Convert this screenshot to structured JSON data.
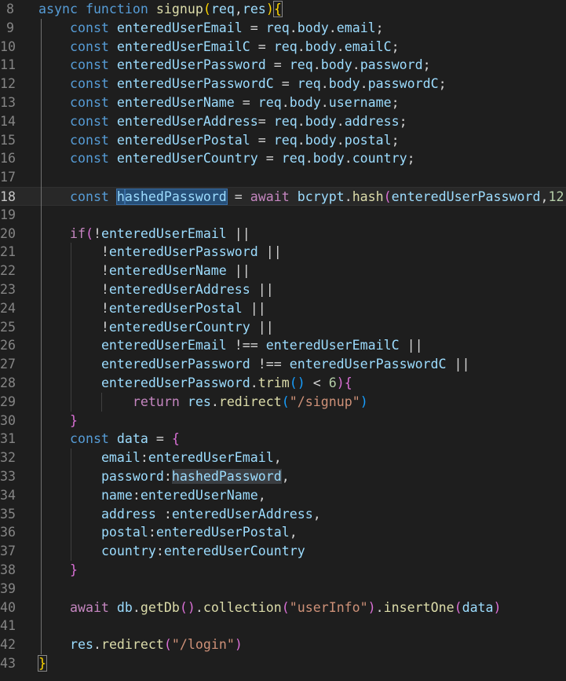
{
  "editor": {
    "current_line": "18",
    "lines": [
      {
        "n": "8",
        "tokens": [
          {
            "t": "async",
            "c": "tok-kw"
          },
          {
            "t": " "
          },
          {
            "t": "function",
            "c": "tok-kw"
          },
          {
            "t": " "
          },
          {
            "t": "signup",
            "c": "tok-fn"
          },
          {
            "t": "(",
            "c": "b1"
          },
          {
            "t": "req",
            "c": "tok-var"
          },
          {
            "t": ","
          },
          {
            "t": "res",
            "c": "tok-var"
          },
          {
            "t": ")",
            "c": "b1"
          },
          {
            "t": "{",
            "c": "b1 hl-bracket"
          }
        ]
      },
      {
        "n": "9",
        "tokens": [
          {
            "t": "    "
          },
          {
            "t": "const",
            "c": "tok-kw"
          },
          {
            "t": " "
          },
          {
            "t": "enteredUserEmail",
            "c": "tok-var"
          },
          {
            "t": " = "
          },
          {
            "t": "req",
            "c": "tok-var"
          },
          {
            "t": "."
          },
          {
            "t": "body",
            "c": "tok-var"
          },
          {
            "t": "."
          },
          {
            "t": "email",
            "c": "tok-var"
          },
          {
            "t": ";"
          }
        ]
      },
      {
        "n": "10",
        "tokens": [
          {
            "t": "    "
          },
          {
            "t": "const",
            "c": "tok-kw"
          },
          {
            "t": " "
          },
          {
            "t": "enteredUserEmailC",
            "c": "tok-var"
          },
          {
            "t": " = "
          },
          {
            "t": "req",
            "c": "tok-var"
          },
          {
            "t": "."
          },
          {
            "t": "body",
            "c": "tok-var"
          },
          {
            "t": "."
          },
          {
            "t": "emailC",
            "c": "tok-var"
          },
          {
            "t": ";"
          }
        ]
      },
      {
        "n": "11",
        "tokens": [
          {
            "t": "    "
          },
          {
            "t": "const",
            "c": "tok-kw"
          },
          {
            "t": " "
          },
          {
            "t": "enteredUserPassword",
            "c": "tok-var"
          },
          {
            "t": " = "
          },
          {
            "t": "req",
            "c": "tok-var"
          },
          {
            "t": "."
          },
          {
            "t": "body",
            "c": "tok-var"
          },
          {
            "t": "."
          },
          {
            "t": "password",
            "c": "tok-var"
          },
          {
            "t": ";"
          }
        ]
      },
      {
        "n": "12",
        "tokens": [
          {
            "t": "    "
          },
          {
            "t": "const",
            "c": "tok-kw"
          },
          {
            "t": " "
          },
          {
            "t": "enteredUserPasswordC",
            "c": "tok-var"
          },
          {
            "t": " = "
          },
          {
            "t": "req",
            "c": "tok-var"
          },
          {
            "t": "."
          },
          {
            "t": "body",
            "c": "tok-var"
          },
          {
            "t": "."
          },
          {
            "t": "passwordC",
            "c": "tok-var"
          },
          {
            "t": ";"
          }
        ]
      },
      {
        "n": "13",
        "tokens": [
          {
            "t": "    "
          },
          {
            "t": "const",
            "c": "tok-kw"
          },
          {
            "t": " "
          },
          {
            "t": "enteredUserName",
            "c": "tok-var"
          },
          {
            "t": " = "
          },
          {
            "t": "req",
            "c": "tok-var"
          },
          {
            "t": "."
          },
          {
            "t": "body",
            "c": "tok-var"
          },
          {
            "t": "."
          },
          {
            "t": "username",
            "c": "tok-var"
          },
          {
            "t": ";"
          }
        ]
      },
      {
        "n": "14",
        "tokens": [
          {
            "t": "    "
          },
          {
            "t": "const",
            "c": "tok-kw"
          },
          {
            "t": " "
          },
          {
            "t": "enteredUserAddress",
            "c": "tok-var"
          },
          {
            "t": "= "
          },
          {
            "t": "req",
            "c": "tok-var"
          },
          {
            "t": "."
          },
          {
            "t": "body",
            "c": "tok-var"
          },
          {
            "t": "."
          },
          {
            "t": "address",
            "c": "tok-var"
          },
          {
            "t": ";"
          }
        ]
      },
      {
        "n": "15",
        "tokens": [
          {
            "t": "    "
          },
          {
            "t": "const",
            "c": "tok-kw"
          },
          {
            "t": " "
          },
          {
            "t": "enteredUserPostal",
            "c": "tok-var"
          },
          {
            "t": " = "
          },
          {
            "t": "req",
            "c": "tok-var"
          },
          {
            "t": "."
          },
          {
            "t": "body",
            "c": "tok-var"
          },
          {
            "t": "."
          },
          {
            "t": "postal",
            "c": "tok-var"
          },
          {
            "t": ";"
          }
        ]
      },
      {
        "n": "16",
        "tokens": [
          {
            "t": "    "
          },
          {
            "t": "const",
            "c": "tok-kw"
          },
          {
            "t": " "
          },
          {
            "t": "enteredUserCountry",
            "c": "tok-var"
          },
          {
            "t": " = "
          },
          {
            "t": "req",
            "c": "tok-var"
          },
          {
            "t": "."
          },
          {
            "t": "body",
            "c": "tok-var"
          },
          {
            "t": "."
          },
          {
            "t": "country",
            "c": "tok-var"
          },
          {
            "t": ";"
          }
        ]
      },
      {
        "n": "17",
        "tokens": []
      },
      {
        "n": "18",
        "tokens": [
          {
            "t": "    "
          },
          {
            "t": "const",
            "c": "tok-kw"
          },
          {
            "t": " "
          },
          {
            "t": "h",
            "c": "tok-var hl-sel"
          },
          {
            "t": "|",
            "c": "cursor"
          },
          {
            "t": "ashedPassword",
            "c": "tok-var hl-sel"
          },
          {
            "t": " = "
          },
          {
            "t": "await",
            "c": "tok-ctl"
          },
          {
            "t": " "
          },
          {
            "t": "bcrypt",
            "c": "tok-var"
          },
          {
            "t": "."
          },
          {
            "t": "hash",
            "c": "tok-fn"
          },
          {
            "t": "(",
            "c": "b2"
          },
          {
            "t": "enteredUserPassword",
            "c": "tok-var"
          },
          {
            "t": ","
          },
          {
            "t": "12",
            "c": "tok-num"
          },
          {
            "t": ")",
            "c": "b2"
          }
        ]
      },
      {
        "n": "19",
        "tokens": []
      },
      {
        "n": "20",
        "tokens": [
          {
            "t": "    "
          },
          {
            "t": "if",
            "c": "tok-ctl"
          },
          {
            "t": "(",
            "c": "b2"
          },
          {
            "t": "!"
          },
          {
            "t": "enteredUserEmail",
            "c": "tok-var"
          },
          {
            "t": " ||"
          }
        ]
      },
      {
        "n": "21",
        "tokens": [
          {
            "t": "        !"
          },
          {
            "t": "enteredUserPassword",
            "c": "tok-var"
          },
          {
            "t": " ||"
          }
        ]
      },
      {
        "n": "22",
        "tokens": [
          {
            "t": "        !"
          },
          {
            "t": "enteredUserName",
            "c": "tok-var"
          },
          {
            "t": " ||"
          }
        ]
      },
      {
        "n": "23",
        "tokens": [
          {
            "t": "        !"
          },
          {
            "t": "enteredUserAddress",
            "c": "tok-var"
          },
          {
            "t": " ||"
          }
        ]
      },
      {
        "n": "24",
        "tokens": [
          {
            "t": "        !"
          },
          {
            "t": "enteredUserPostal",
            "c": "tok-var"
          },
          {
            "t": " ||"
          }
        ]
      },
      {
        "n": "25",
        "tokens": [
          {
            "t": "        !"
          },
          {
            "t": "enteredUserCountry",
            "c": "tok-var"
          },
          {
            "t": " ||"
          }
        ]
      },
      {
        "n": "26",
        "tokens": [
          {
            "t": "        "
          },
          {
            "t": "enteredUserEmail",
            "c": "tok-var"
          },
          {
            "t": " !== "
          },
          {
            "t": "enteredUserEmailC",
            "c": "tok-var"
          },
          {
            "t": " ||"
          }
        ]
      },
      {
        "n": "27",
        "tokens": [
          {
            "t": "        "
          },
          {
            "t": "enteredUserPassword",
            "c": "tok-var"
          },
          {
            "t": " !== "
          },
          {
            "t": "enteredUserPasswordC",
            "c": "tok-var"
          },
          {
            "t": " ||"
          }
        ]
      },
      {
        "n": "28",
        "tokens": [
          {
            "t": "        "
          },
          {
            "t": "enteredUserPassword",
            "c": "tok-var"
          },
          {
            "t": "."
          },
          {
            "t": "trim",
            "c": "tok-fn"
          },
          {
            "t": "()",
            "c": "b3"
          },
          {
            "t": " < "
          },
          {
            "t": "6",
            "c": "tok-num"
          },
          {
            "t": ")",
            "c": "b2"
          },
          {
            "t": "{",
            "c": "b2"
          }
        ]
      },
      {
        "n": "29",
        "tokens": [
          {
            "t": "            "
          },
          {
            "t": "return",
            "c": "tok-ctl"
          },
          {
            "t": " "
          },
          {
            "t": "res",
            "c": "tok-var"
          },
          {
            "t": "."
          },
          {
            "t": "redirect",
            "c": "tok-fn"
          },
          {
            "t": "(",
            "c": "b3"
          },
          {
            "t": "\"/signup\"",
            "c": "tok-str"
          },
          {
            "t": ")",
            "c": "b3"
          }
        ]
      },
      {
        "n": "30",
        "tokens": [
          {
            "t": "    "
          },
          {
            "t": "}",
            "c": "b2"
          }
        ]
      },
      {
        "n": "31",
        "tokens": [
          {
            "t": "    "
          },
          {
            "t": "const",
            "c": "tok-kw"
          },
          {
            "t": " "
          },
          {
            "t": "data",
            "c": "tok-var"
          },
          {
            "t": " = "
          },
          {
            "t": "{",
            "c": "b2"
          }
        ]
      },
      {
        "n": "32",
        "tokens": [
          {
            "t": "        "
          },
          {
            "t": "email",
            "c": "tok-var"
          },
          {
            "t": ":"
          },
          {
            "t": "enteredUserEmail",
            "c": "tok-var"
          },
          {
            "t": ","
          }
        ]
      },
      {
        "n": "33",
        "tokens": [
          {
            "t": "        "
          },
          {
            "t": "password",
            "c": "tok-var"
          },
          {
            "t": ":"
          },
          {
            "t": "hashedPassword",
            "c": "tok-var hl-word"
          },
          {
            "t": ","
          }
        ]
      },
      {
        "n": "34",
        "tokens": [
          {
            "t": "        "
          },
          {
            "t": "name",
            "c": "tok-var"
          },
          {
            "t": ":"
          },
          {
            "t": "enteredUserName",
            "c": "tok-var"
          },
          {
            "t": ","
          }
        ]
      },
      {
        "n": "35",
        "tokens": [
          {
            "t": "        "
          },
          {
            "t": "address",
            "c": "tok-var"
          },
          {
            "t": " :"
          },
          {
            "t": "enteredUserAddress",
            "c": "tok-var"
          },
          {
            "t": ","
          }
        ]
      },
      {
        "n": "36",
        "tokens": [
          {
            "t": "        "
          },
          {
            "t": "postal",
            "c": "tok-var"
          },
          {
            "t": ":"
          },
          {
            "t": "enteredUserPostal",
            "c": "tok-var"
          },
          {
            "t": ","
          }
        ]
      },
      {
        "n": "37",
        "tokens": [
          {
            "t": "        "
          },
          {
            "t": "country",
            "c": "tok-var"
          },
          {
            "t": ":"
          },
          {
            "t": "enteredUserCountry",
            "c": "tok-var"
          }
        ]
      },
      {
        "n": "38",
        "tokens": [
          {
            "t": "    "
          },
          {
            "t": "}",
            "c": "b2"
          }
        ]
      },
      {
        "n": "39",
        "tokens": []
      },
      {
        "n": "40",
        "tokens": [
          {
            "t": "    "
          },
          {
            "t": "await",
            "c": "tok-ctl"
          },
          {
            "t": " "
          },
          {
            "t": "db",
            "c": "tok-var"
          },
          {
            "t": "."
          },
          {
            "t": "getDb",
            "c": "tok-fn"
          },
          {
            "t": "()",
            "c": "b2"
          },
          {
            "t": "."
          },
          {
            "t": "collection",
            "c": "tok-fn"
          },
          {
            "t": "(",
            "c": "b2"
          },
          {
            "t": "\"userInfo\"",
            "c": "tok-str"
          },
          {
            "t": ")",
            "c": "b2"
          },
          {
            "t": "."
          },
          {
            "t": "insertOne",
            "c": "tok-fn"
          },
          {
            "t": "(",
            "c": "b2"
          },
          {
            "t": "data",
            "c": "tok-var"
          },
          {
            "t": ")",
            "c": "b2"
          }
        ]
      },
      {
        "n": "41",
        "tokens": []
      },
      {
        "n": "42",
        "tokens": [
          {
            "t": "    "
          },
          {
            "t": "res",
            "c": "tok-var"
          },
          {
            "t": "."
          },
          {
            "t": "redirect",
            "c": "tok-fn"
          },
          {
            "t": "(",
            "c": "b2"
          },
          {
            "t": "\"/login\"",
            "c": "tok-str"
          },
          {
            "t": ")",
            "c": "b2"
          }
        ]
      },
      {
        "n": "43",
        "tokens": [
          {
            "t": "}",
            "c": "b1 hl-bracket"
          }
        ]
      }
    ]
  }
}
